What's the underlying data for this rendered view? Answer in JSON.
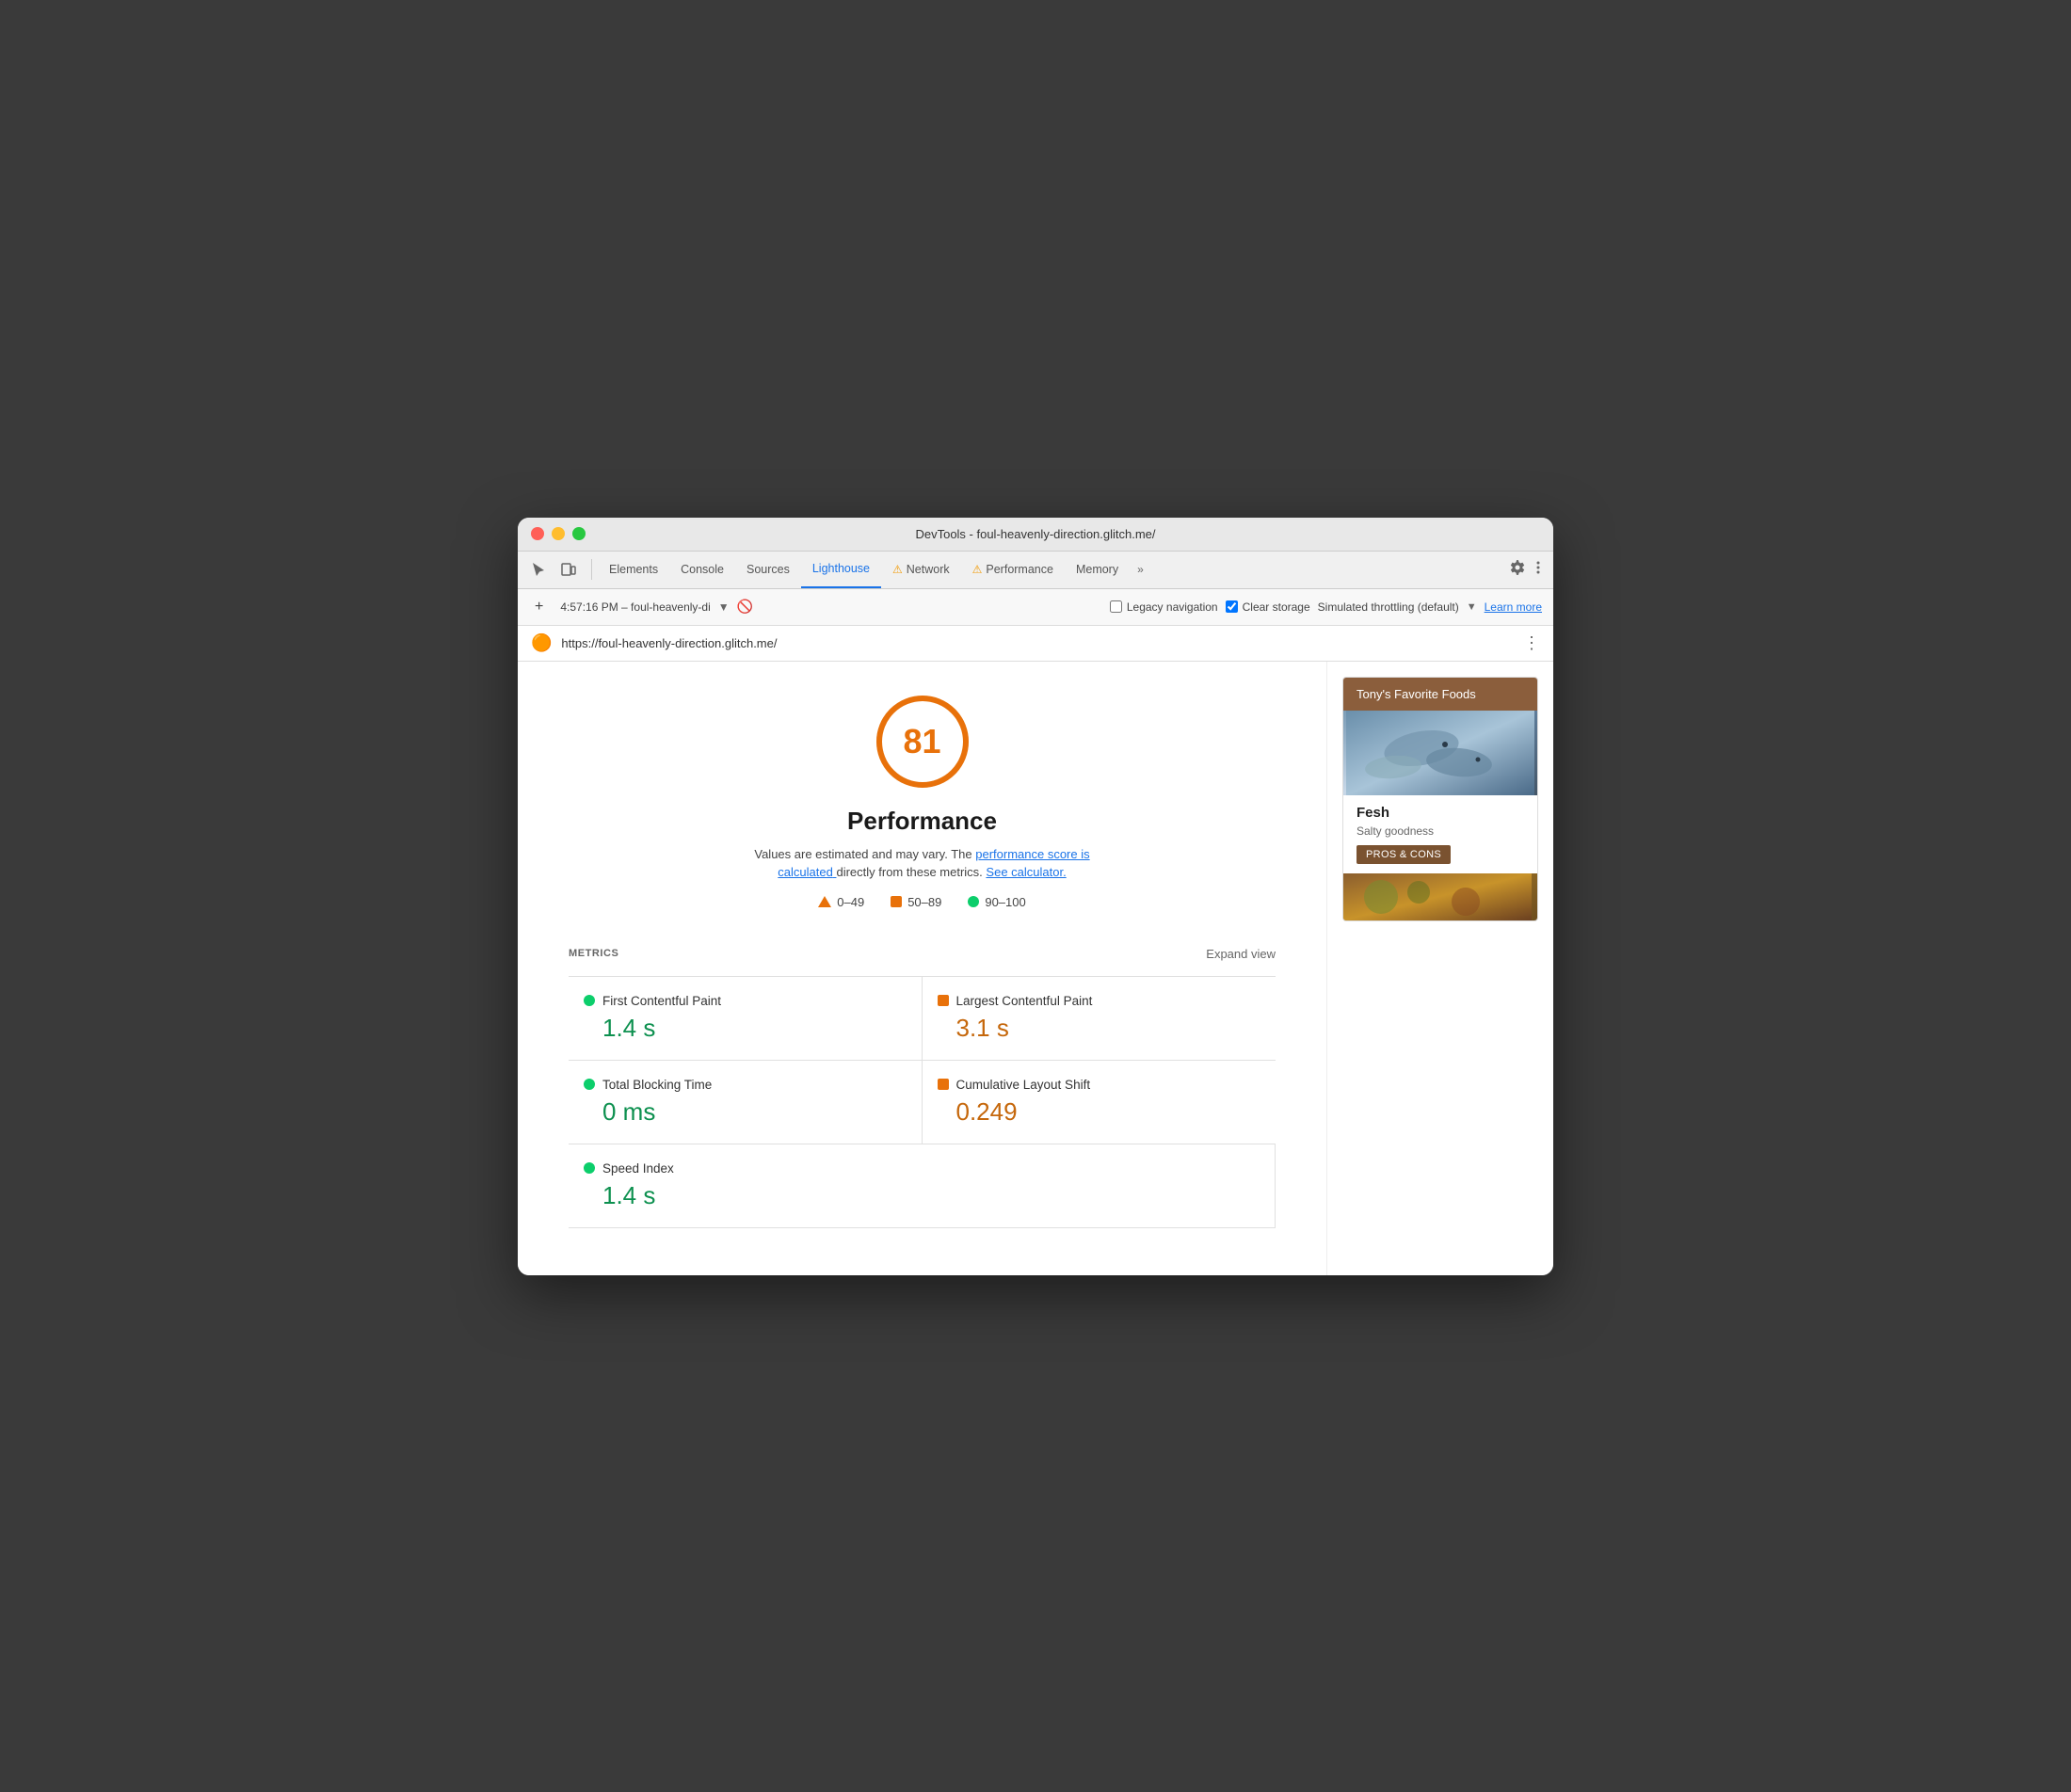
{
  "window": {
    "title": "DevTools - foul-heavenly-direction.glitch.me/"
  },
  "tabs": {
    "elements": "Elements",
    "console": "Console",
    "sources": "Sources",
    "lighthouse": "Lighthouse",
    "network": "Network",
    "performance": "Performance",
    "memory": "Memory",
    "overflow": "»"
  },
  "toolbar": {
    "time": "4:57:16 PM – foul-heavenly-di",
    "legacy_navigation_label": "Legacy navigation",
    "clear_storage_label": "Clear storage",
    "throttling_label": "Simulated throttling (default)",
    "learn_more": "Learn more"
  },
  "url_bar": {
    "url": "https://foul-heavenly-direction.glitch.me/"
  },
  "metrics_section": {
    "title": "METRICS",
    "expand_view": "Expand view",
    "items": [
      {
        "label": "First Contentful Paint",
        "value": "1.4 s",
        "status": "green"
      },
      {
        "label": "Largest Contentful Paint",
        "value": "3.1 s",
        "status": "orange"
      },
      {
        "label": "Total Blocking Time",
        "value": "0 ms",
        "status": "green"
      },
      {
        "label": "Cumulative Layout Shift",
        "value": "0.249",
        "status": "orange"
      },
      {
        "label": "Speed Index",
        "value": "1.4 s",
        "status": "green"
      }
    ]
  },
  "score": {
    "value": "81",
    "title": "Performance",
    "description_start": "Values are estimated and may vary. The",
    "description_link1": "performance score is calculated",
    "description_mid": "directly from these metrics.",
    "description_link2": "See calculator.",
    "legend": [
      {
        "label": "0–49",
        "type": "triangle"
      },
      {
        "label": "50–89",
        "type": "square"
      },
      {
        "label": "90–100",
        "type": "circle"
      }
    ]
  },
  "preview": {
    "header": "Tony's Favorite Foods",
    "item_title": "Fesh",
    "item_subtitle": "Salty goodness",
    "pros_cons_label": "PROS & CONS"
  }
}
